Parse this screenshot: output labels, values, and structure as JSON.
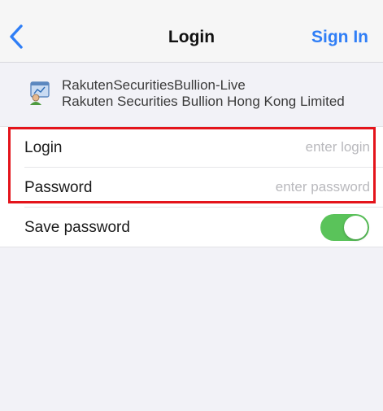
{
  "navbar": {
    "title": "Login",
    "sign_in_label": "Sign In"
  },
  "server": {
    "name": "RakutenSecuritiesBullion-Live",
    "company": "Rakuten Securities Bullion Hong Kong Limited"
  },
  "form": {
    "login": {
      "label": "Login",
      "placeholder": "enter login",
      "value": ""
    },
    "password": {
      "label": "Password",
      "placeholder": "enter password",
      "value": ""
    },
    "save_password": {
      "label": "Save password",
      "enabled": true
    }
  },
  "colors": {
    "accent": "#2f7ef6",
    "toggle_on": "#5ac35a",
    "highlight": "#e4141b"
  },
  "icons": {
    "back": "chevron-left-icon",
    "server": "server-icon"
  }
}
